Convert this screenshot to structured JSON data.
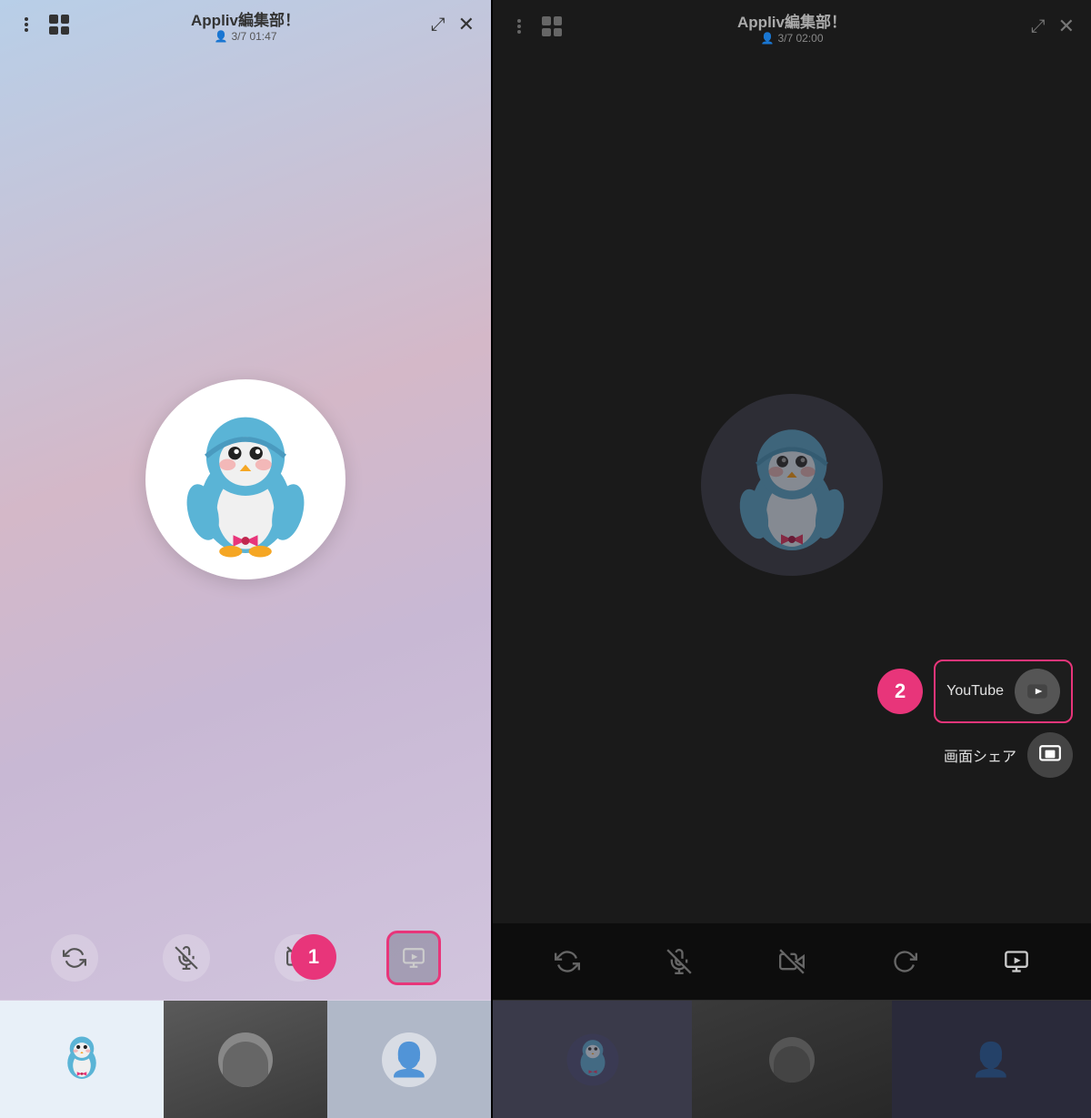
{
  "left": {
    "header": {
      "title": "Appliv編集部！",
      "subtitle": "3/7  01:47",
      "person_icon": "👤"
    },
    "toolbar": {
      "rotate_label": "rotate",
      "mic_label": "mute",
      "video_label": "video-off",
      "share_label": "share",
      "play_label": "play"
    },
    "badge1": "1",
    "thumbnails": [
      "thumb1",
      "thumb2",
      "thumb3"
    ]
  },
  "right": {
    "header": {
      "title": "Appliv編集部！",
      "subtitle": "3/7  02:00",
      "person_icon": "👤"
    },
    "share_menu": {
      "youtube_label": "YouTube",
      "screen_share_label": "画面シェア"
    },
    "badge2": "2",
    "thumbnails": [
      "thumb1",
      "thumb2",
      "thumb3"
    ]
  }
}
